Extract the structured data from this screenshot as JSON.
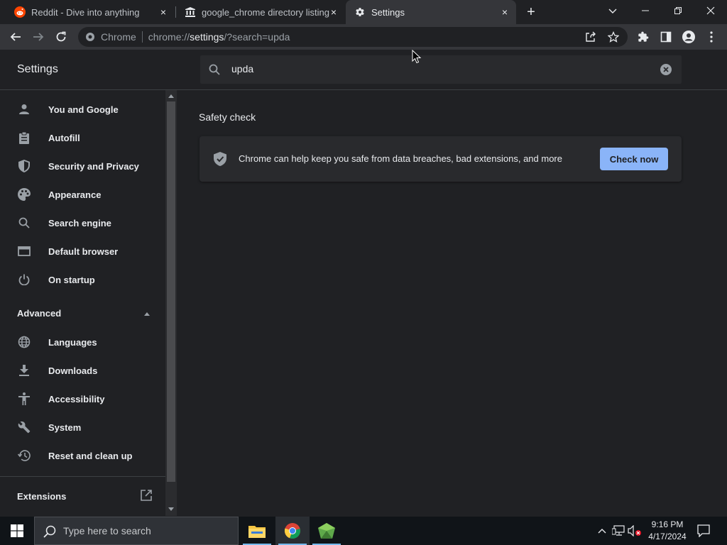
{
  "tabs": [
    {
      "title": "Reddit - Dive into anything",
      "icon": "reddit-icon",
      "close": "×"
    },
    {
      "title": "google_chrome directory listing",
      "icon": "bank-icon",
      "close": "×"
    },
    {
      "title": "Settings",
      "icon": "gear-icon",
      "close": "×"
    }
  ],
  "new_tab": "+",
  "omnibox": {
    "site_label": "Chrome",
    "url_scheme": "chrome://",
    "url_host": "settings",
    "url_path": "/?search=upda"
  },
  "settings": {
    "title": "Settings",
    "search_value": "upda"
  },
  "sidebar": {
    "items": [
      {
        "label": "You and Google",
        "icon": "person-icon"
      },
      {
        "label": "Autofill",
        "icon": "clipboard-icon"
      },
      {
        "label": "Security and Privacy",
        "icon": "shield-icon"
      },
      {
        "label": "Appearance",
        "icon": "palette-icon"
      },
      {
        "label": "Search engine",
        "icon": "search-icon"
      },
      {
        "label": "Default browser",
        "icon": "browser-icon"
      },
      {
        "label": "On startup",
        "icon": "power-icon"
      }
    ],
    "advanced_label": "Advanced",
    "advanced_items": [
      {
        "label": "Languages",
        "icon": "globe-icon"
      },
      {
        "label": "Downloads",
        "icon": "download-icon"
      },
      {
        "label": "Accessibility",
        "icon": "accessibility-icon"
      },
      {
        "label": "System",
        "icon": "wrench-icon"
      },
      {
        "label": "Reset and clean up",
        "icon": "history-icon"
      }
    ],
    "extensions_label": "Extensions"
  },
  "main": {
    "section_title": "Safety check",
    "card_text": "Chrome can help keep you safe from data breaches, bad extensions, and more",
    "check_button": "Check now"
  },
  "taskbar": {
    "search_placeholder": "Type here to search",
    "time": "9:16 PM",
    "date": "4/17/2024"
  },
  "colors": {
    "accent": "#8ab4f8",
    "background": "#202124",
    "toolbar": "#35363a",
    "taskbar": "#101418"
  }
}
